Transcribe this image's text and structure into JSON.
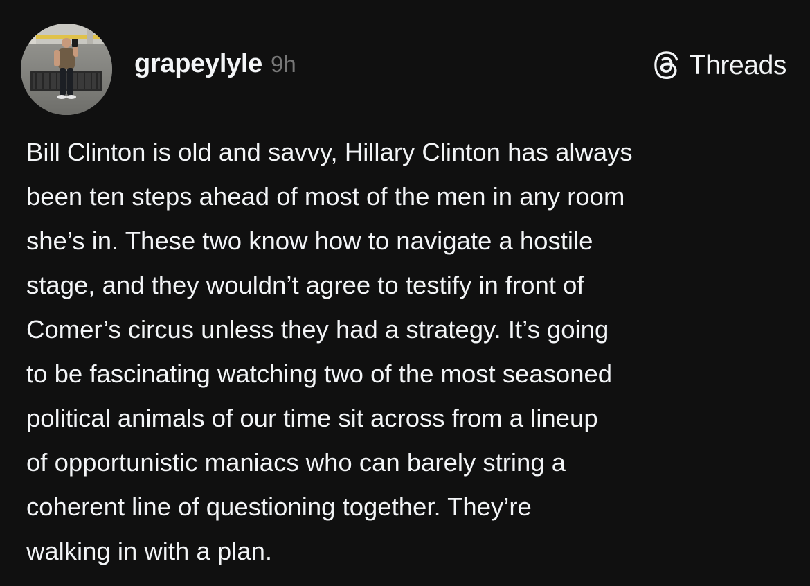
{
  "post": {
    "author": {
      "username": "grapeylyle",
      "timestamp": "9h",
      "avatar_description": "profile-photo"
    },
    "platform": {
      "label": "Threads",
      "icon": "threads-logo-icon"
    },
    "body_lines": [
      "Bill Clinton is old and savvy, Hillary Clinton has always",
      "been ten steps ahead of most of the men in any room",
      "she’s in. These two know how to navigate a hostile",
      "stage, and they wouldn’t agree to testify in front of",
      "Comer’s circus unless they had a strategy. It’s going",
      "to be fascinating watching two of the most seasoned",
      "political animals of our time sit across from a lineup",
      "of opportunistic maniacs who can barely string a",
      "coherent line of questioning together. They’re",
      "walking in with a plan."
    ]
  },
  "colors": {
    "background": "#101010",
    "primary_text": "#f3f5f7",
    "secondary_text": "#777777"
  }
}
